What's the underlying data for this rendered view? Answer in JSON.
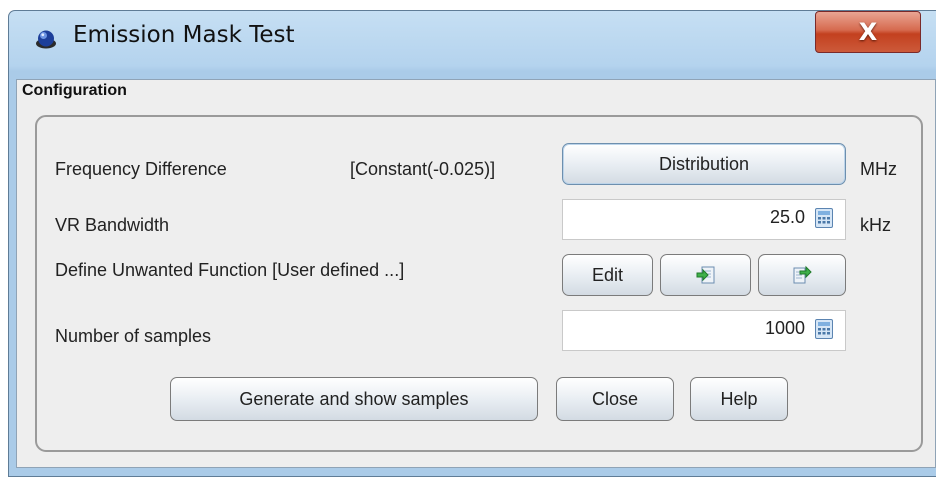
{
  "window": {
    "title": "Emission Mask Test",
    "close_label": "X"
  },
  "group": {
    "title": "Configuration"
  },
  "rows": {
    "frequency": {
      "label": "Frequency Difference",
      "value_text": "[Constant(-0.025)]",
      "button_label": "Distribution",
      "unit": "MHz"
    },
    "bandwidth": {
      "label": "VR Bandwidth",
      "value": "25.0",
      "unit": "kHz"
    },
    "unwanted": {
      "label": "Define Unwanted Function [User defined ...]",
      "edit_label": "Edit",
      "import_icon": "import-icon",
      "export_icon": "export-icon"
    },
    "samples": {
      "label": "Number of samples",
      "value": "1000"
    }
  },
  "buttons": {
    "generate": "Generate and show samples",
    "close": "Close",
    "help": "Help"
  },
  "colors": {
    "title_bar": "#b4d3ee",
    "close_button": "#c3401f",
    "panel_background": "#eeeeee"
  }
}
